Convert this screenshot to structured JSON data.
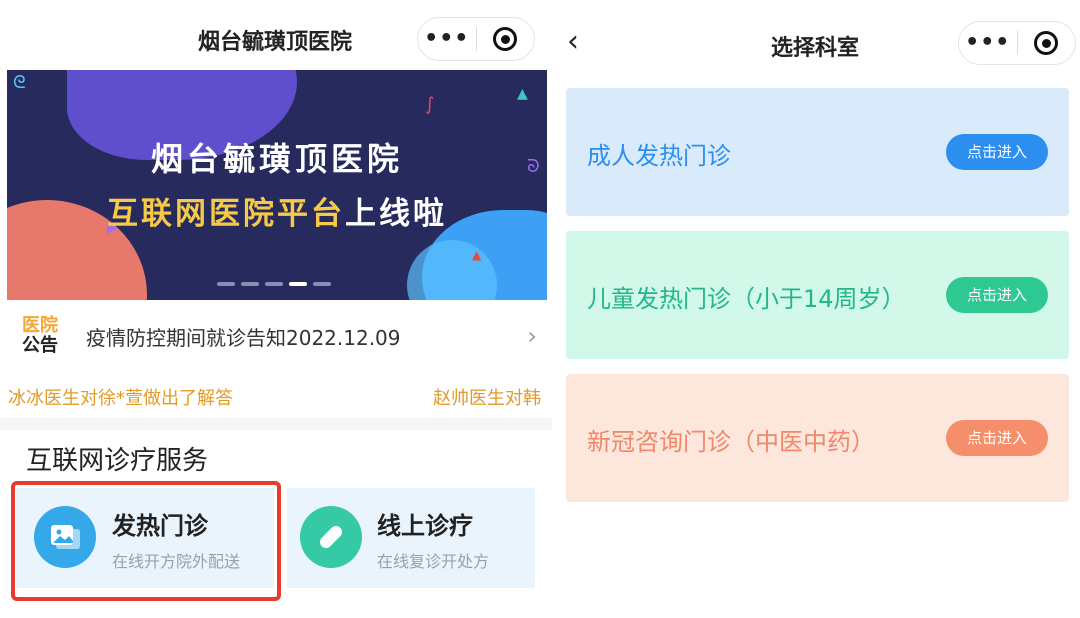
{
  "left": {
    "title": "烟台毓璜顶医院",
    "capsule": {
      "more_icon": "more-dots-icon",
      "close_icon": "target-close-icon"
    },
    "banner": {
      "line1": "烟台毓璜顶医院",
      "line2_highlight": "互联网医院平台",
      "line2_rest": "上线啦",
      "active_dot": 4,
      "dot_count": 5
    },
    "notice": {
      "tag_top": "医院",
      "tag_bottom": "公告",
      "text": "疫情防控期间就诊告知2022.12.09",
      "chevron": "chevron-right-icon"
    },
    "marquee": [
      "冰冰医生对徐*萱做出了解答",
      "赵帅医生对韩"
    ],
    "section_title": "互联网诊疗服务",
    "services": [
      {
        "title": "发热门诊",
        "subtitle": "在线开方院外配送",
        "icon": "photo-card-icon",
        "highlighted": true
      },
      {
        "title": "线上诊疗",
        "subtitle": "在线复诊开处方",
        "icon": "pill-icon",
        "highlighted": false
      }
    ]
  },
  "right": {
    "title": "选择科室",
    "back_icon": "chevron-left-icon",
    "departments": [
      {
        "name": "成人发热门诊",
        "button": "点击进入",
        "color": "#2c8ff0"
      },
      {
        "name": "儿童发热门诊（小于14周岁）",
        "button": "点击进入",
        "color": "#21b78c"
      },
      {
        "name": "新冠咨询门诊（中医中药）",
        "button": "点击进入",
        "color": "#f0886a"
      }
    ]
  },
  "colors": {
    "highlight_border": "#e63b2e",
    "banner_bg": "#262a5c",
    "accent_yellow": "#f7c948"
  }
}
